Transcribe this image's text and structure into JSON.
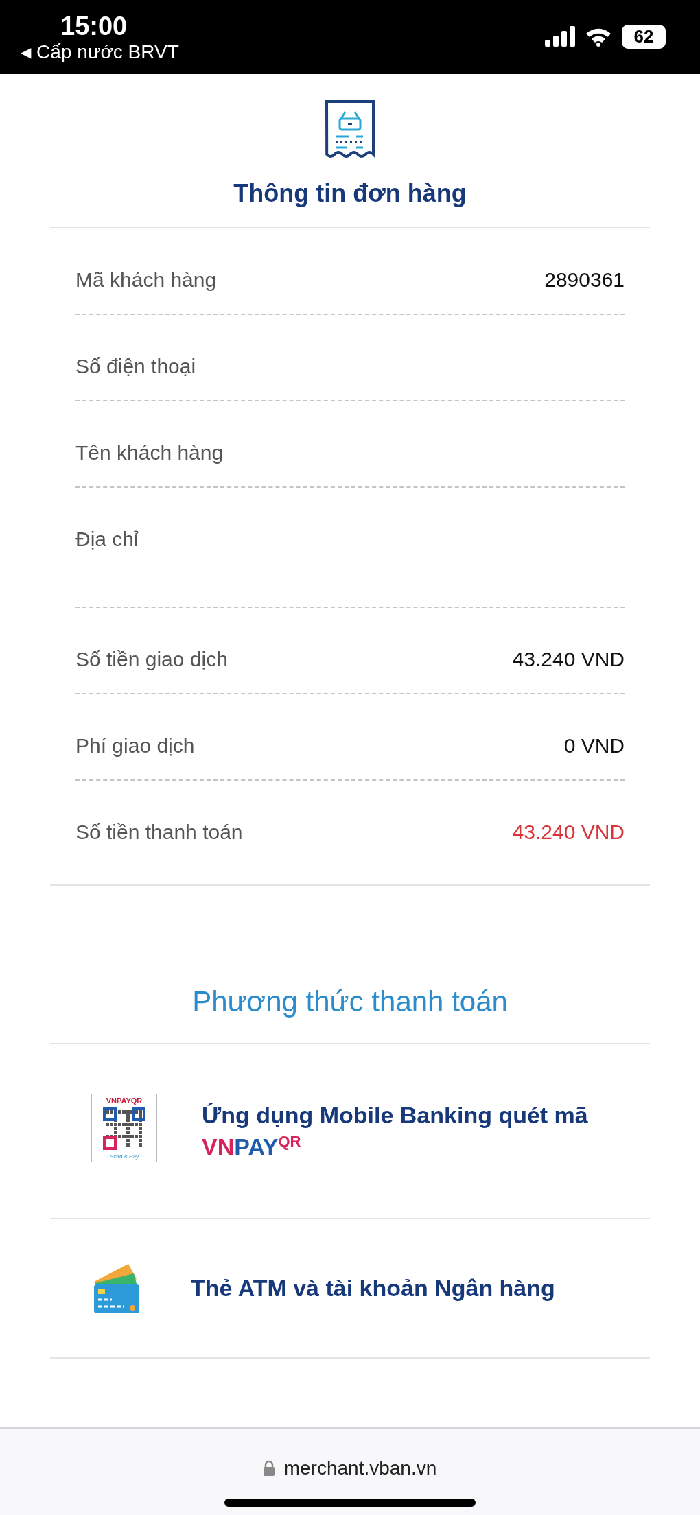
{
  "status_bar": {
    "time": "15:00",
    "back_arrow": "◀",
    "back_label": "Cấp nước BRVT",
    "battery": "62"
  },
  "order": {
    "title": "Thông tin đơn hàng",
    "rows": [
      {
        "kind": "plain",
        "label": "Mã khách hàng",
        "value": "2890361"
      },
      {
        "kind": "plain",
        "label": "Số điện thoại"
      },
      {
        "kind": "plain",
        "label": "Tên khách hàng"
      },
      {
        "kind": "address",
        "label": "Địa chỉ"
      },
      {
        "kind": "plain",
        "label": "Số tiền giao dịch",
        "value": "43.240 VND"
      },
      {
        "kind": "plain",
        "label": "Phí giao dịch",
        "value": "0 VND"
      },
      {
        "kind": "total",
        "label": "Số tiền thanh toán",
        "value": "43.240 VND"
      }
    ]
  },
  "payment": {
    "title": "Phương thức thanh toán",
    "methods": [
      {
        "kind": "qr",
        "title": "Ứng dụng Mobile Banking quét mã",
        "brand": {
          "part1": "VN",
          "part2": "PAY",
          "sup": "QR"
        },
        "logo_brand": "VNPAYQR",
        "logo_caption": "Scan & Pay"
      },
      {
        "kind": "card",
        "title": "Thẻ ATM và tài khoản Ngân hàng"
      }
    ]
  },
  "browser": {
    "url": "merchant.vban.vn"
  }
}
